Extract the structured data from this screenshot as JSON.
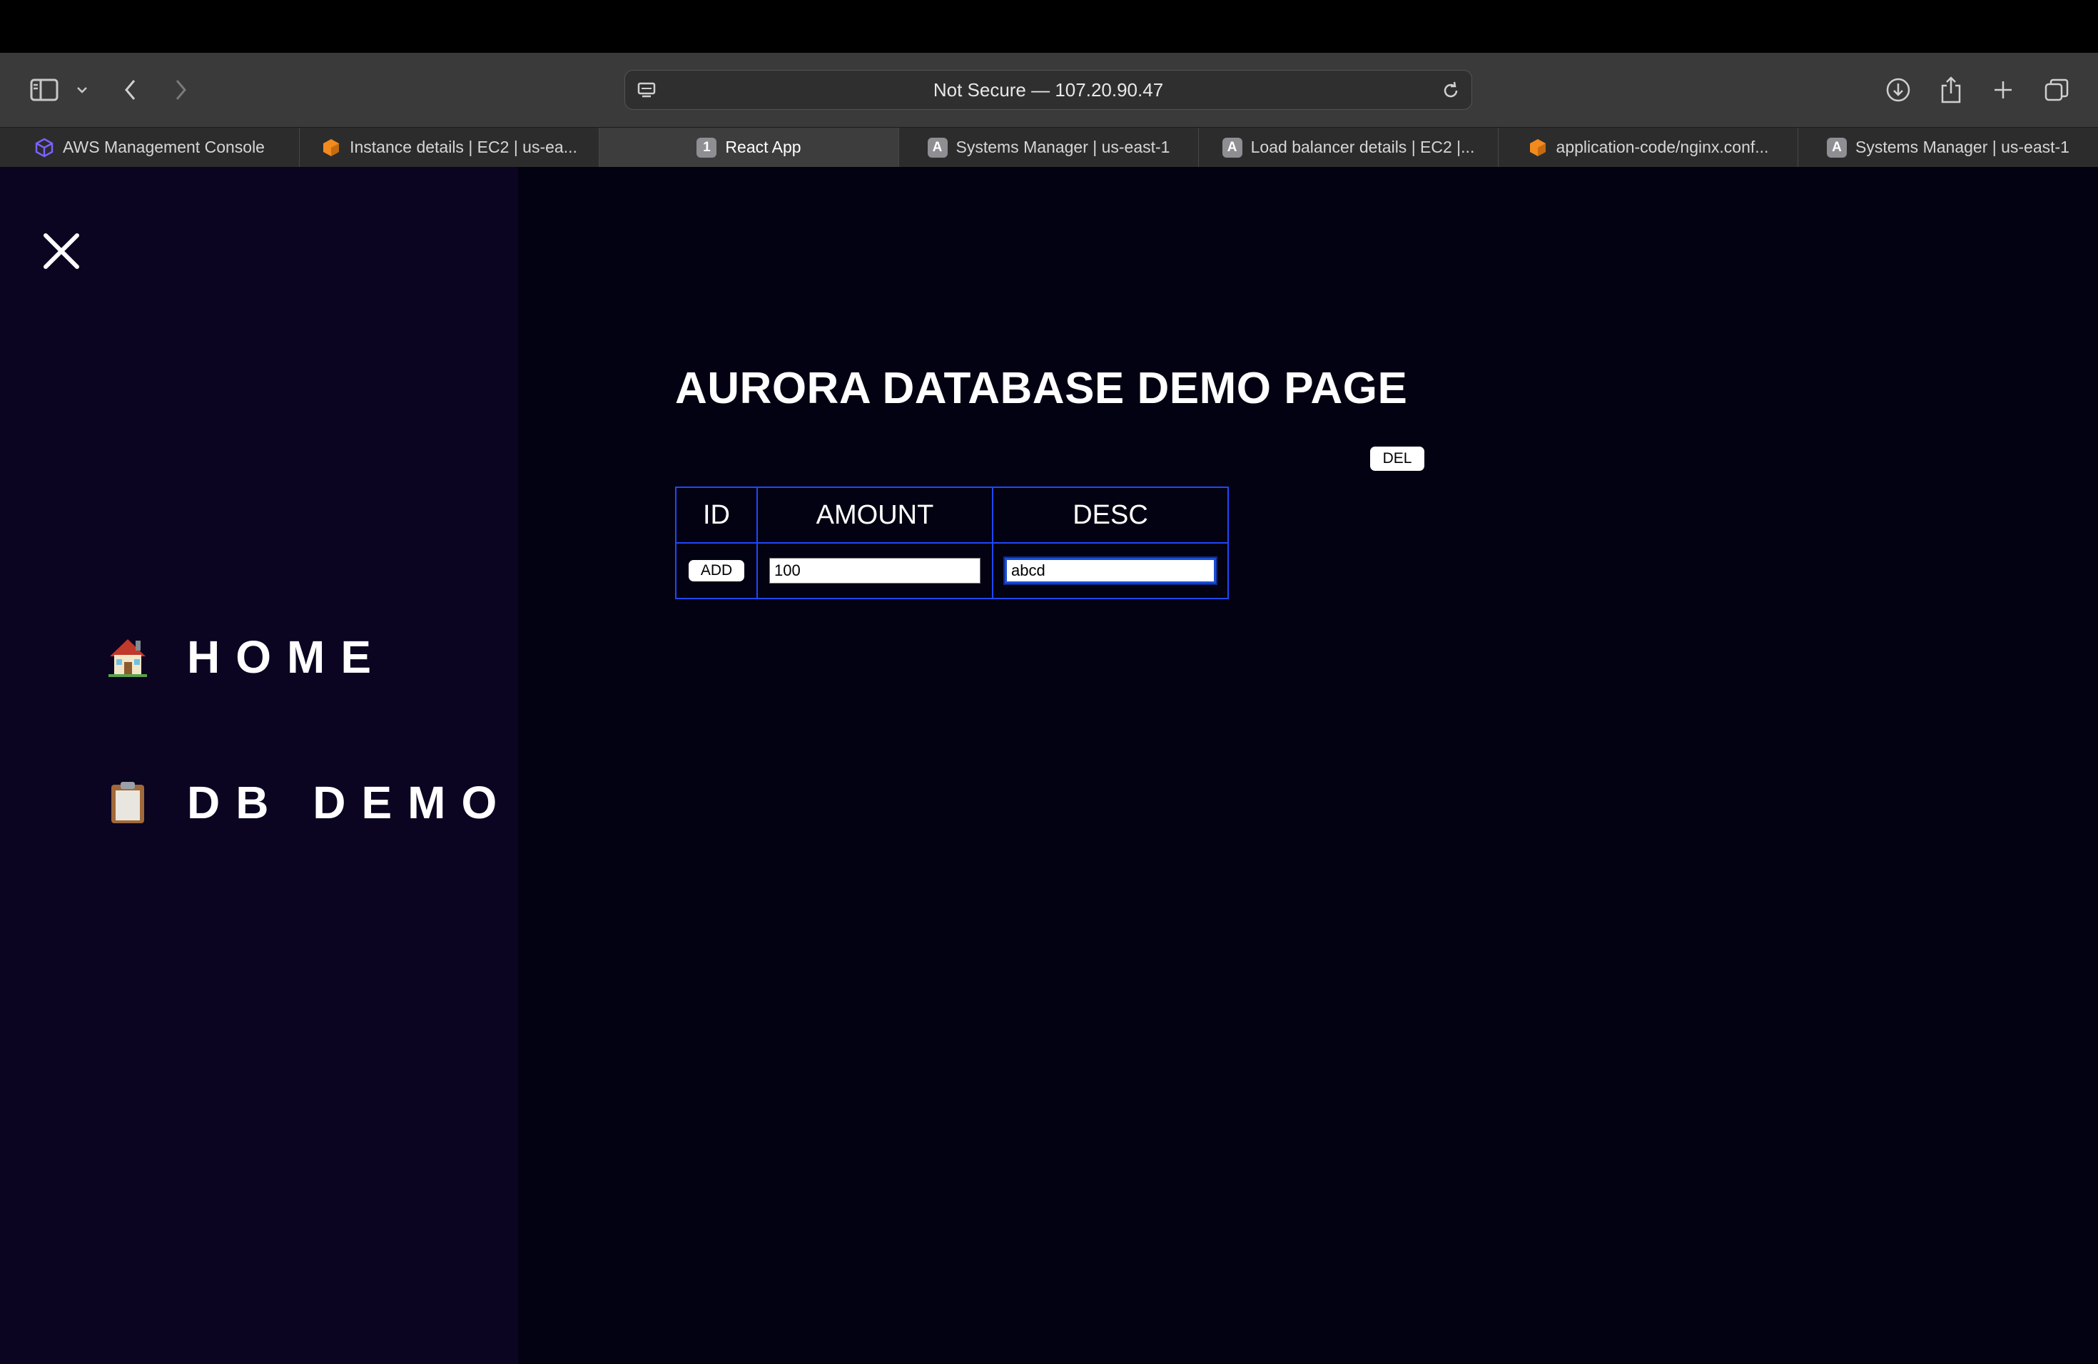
{
  "browser": {
    "address_text": "Not Secure — 107.20.90.47",
    "tabs": [
      {
        "title": "AWS Management Console",
        "favicon": "aws-cube-icon",
        "favicon_color": "#7b61ff",
        "active": false
      },
      {
        "title": "Instance details | EC2 | us-ea...",
        "favicon": "aws-orange-cube-icon",
        "favicon_color": "#f38a1d",
        "active": false
      },
      {
        "title": "React App",
        "favicon_letter": "1",
        "active": true
      },
      {
        "title": "Systems Manager | us-east-1",
        "favicon_letter": "A",
        "active": false
      },
      {
        "title": "Load balancer details | EC2 |...",
        "favicon_letter": "A",
        "active": false
      },
      {
        "title": "application-code/nginx.conf...",
        "favicon": "aws-orange-cube-icon",
        "favicon_color": "#f38a1d",
        "active": false
      },
      {
        "title": "Systems Manager | us-east-1",
        "favicon_letter": "A",
        "active": false
      }
    ]
  },
  "sidebar": {
    "items": [
      {
        "label": "HOME",
        "icon": "house-icon"
      },
      {
        "label": "DB DEMO",
        "icon": "clipboard-icon"
      }
    ]
  },
  "main": {
    "title": "AURORA DATABASE DEMO PAGE",
    "del_label": "DEL",
    "table": {
      "headers": [
        "ID",
        "AMOUNT",
        "DESC"
      ],
      "add_label": "ADD",
      "amount_value": "100",
      "desc_value": "abcd"
    }
  },
  "colors": {
    "sidebar_bg": "#0b0522",
    "content_bg": "#030212",
    "table_border": "#1f47ff"
  }
}
